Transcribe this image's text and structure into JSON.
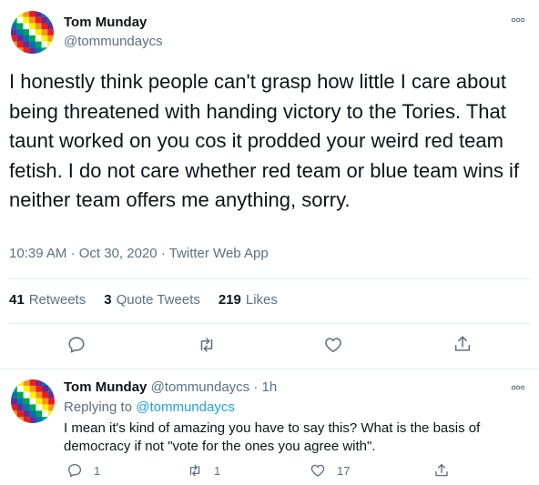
{
  "main_tweet": {
    "author_name": "Tom Munday",
    "author_handle": "@tommundaycs",
    "text": "I honestly think people can't grasp how little I care about being threatened with handing victory to the Tories. That taunt worked on you cos it prodded your weird red team fetish. I do not care whether red team or blue team wins if neither team offers me anything, sorry.",
    "time": "10:39 AM",
    "date": "Oct 30, 2020",
    "separator": "·",
    "source": "Twitter Web App",
    "stats": {
      "retweets_count": "41",
      "retweets_label": "Retweets",
      "quotes_count": "3",
      "quotes_label": "Quote Tweets",
      "likes_count": "219",
      "likes_label": "Likes"
    }
  },
  "reply_tweet": {
    "author_name": "Tom Munday",
    "author_handle": "@tommundaycs",
    "time_ago": "1h",
    "separator": "·",
    "replying_to_label": "Replying to",
    "replying_to_handle": "@tommundaycs",
    "text": "I mean it's kind of amazing you have to say this? What is the basis of democracy if not \"vote for the ones you agree with\".",
    "reply_count": "1",
    "retweet_count": "1",
    "like_count": "17"
  },
  "colors": {
    "text_primary": "#0f1419",
    "text_secondary": "#5b7083",
    "link": "#1da1f2",
    "divider": "#e6ecf0"
  },
  "icons": {
    "more": "more-dots-icon",
    "reply": "reply-bubble-icon",
    "retweet": "retweet-arrows-icon",
    "like": "heart-icon",
    "share": "share-upload-icon",
    "avatar": "wiphala-flag-avatar"
  }
}
